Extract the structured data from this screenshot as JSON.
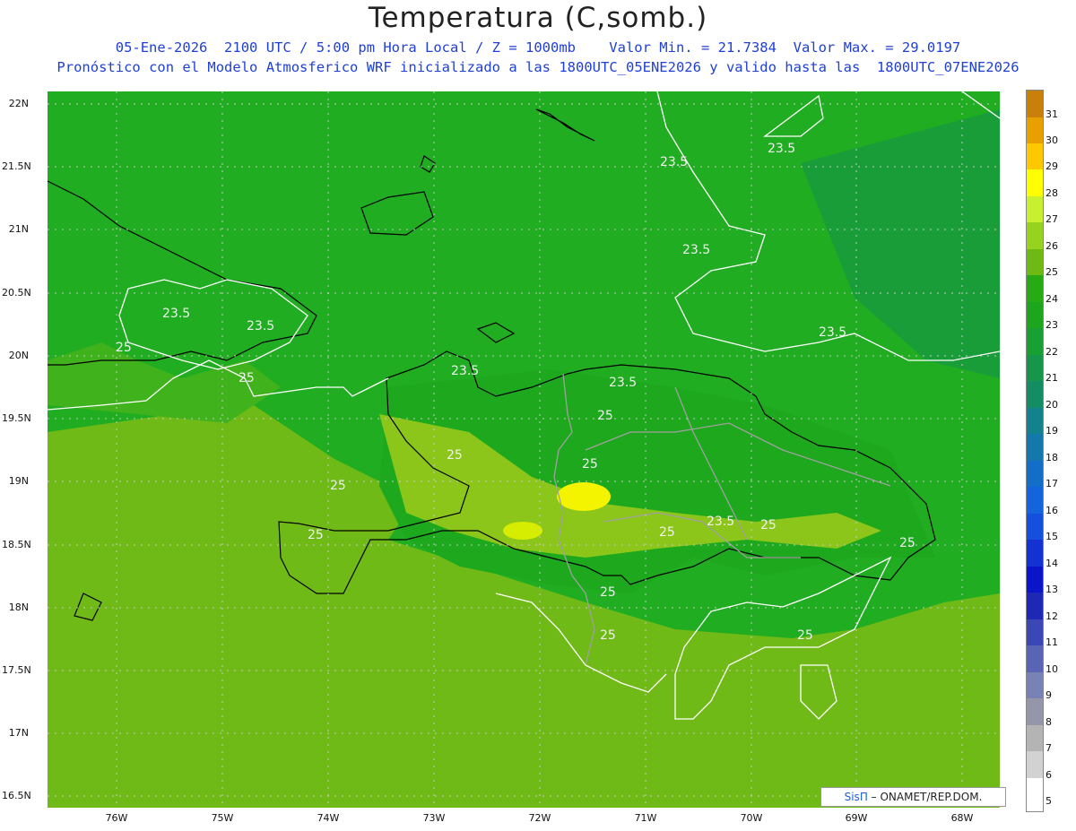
{
  "title": "Temperatura (C,somb.)",
  "subtitle1": "05-Ene-2026  2100 UTC / 5:00 pm Hora Local / Z = 1000mb    Valor Min. = 21.7384  Valor Max. = 29.0197",
  "subtitle2": "Pronóstico con el Modelo Atmosferico WRF inicializado a las 1800UTC_05ENE2026 y valido hasta las  1800UTC_07ENE2026",
  "credit": {
    "sis": "SisΠ",
    "rest": "– ONAMET/REP.DOM."
  },
  "lat_labels": [
    "22N",
    "21.5N",
    "21N",
    "20.5N",
    "20N",
    "19.5N",
    "19N",
    "18.5N",
    "18N",
    "17.5N",
    "17N",
    "16.5N"
  ],
  "lon_labels": [
    "76W",
    "75W",
    "74W",
    "73W",
    "72W",
    "71W",
    "70W",
    "69W",
    "68W"
  ],
  "legend_values": [
    "31",
    "30",
    "29",
    "28",
    "27",
    "26",
    "25",
    "24",
    "23",
    "22",
    "21",
    "20",
    "19",
    "18",
    "17",
    "16",
    "15",
    "14",
    "13",
    "12",
    "11",
    "10",
    "9",
    "8",
    "7",
    "6",
    "5"
  ],
  "contour_labels": [
    "23.5",
    "23.5",
    "23.5",
    "23.5",
    "23.5",
    "23.5",
    "23.5",
    "23.5",
    "23.5",
    "25",
    "25",
    "25",
    "25",
    "25",
    "25",
    "25",
    "25",
    "25",
    "25",
    "25",
    "25",
    "25"
  ],
  "colors": {
    "background": "#1aa61a",
    "land_warm": "#7cbf1a",
    "hot": "#ffff00",
    "contour": "#ffffff",
    "coast": "#000000",
    "border": "#a0a0a0"
  }
}
